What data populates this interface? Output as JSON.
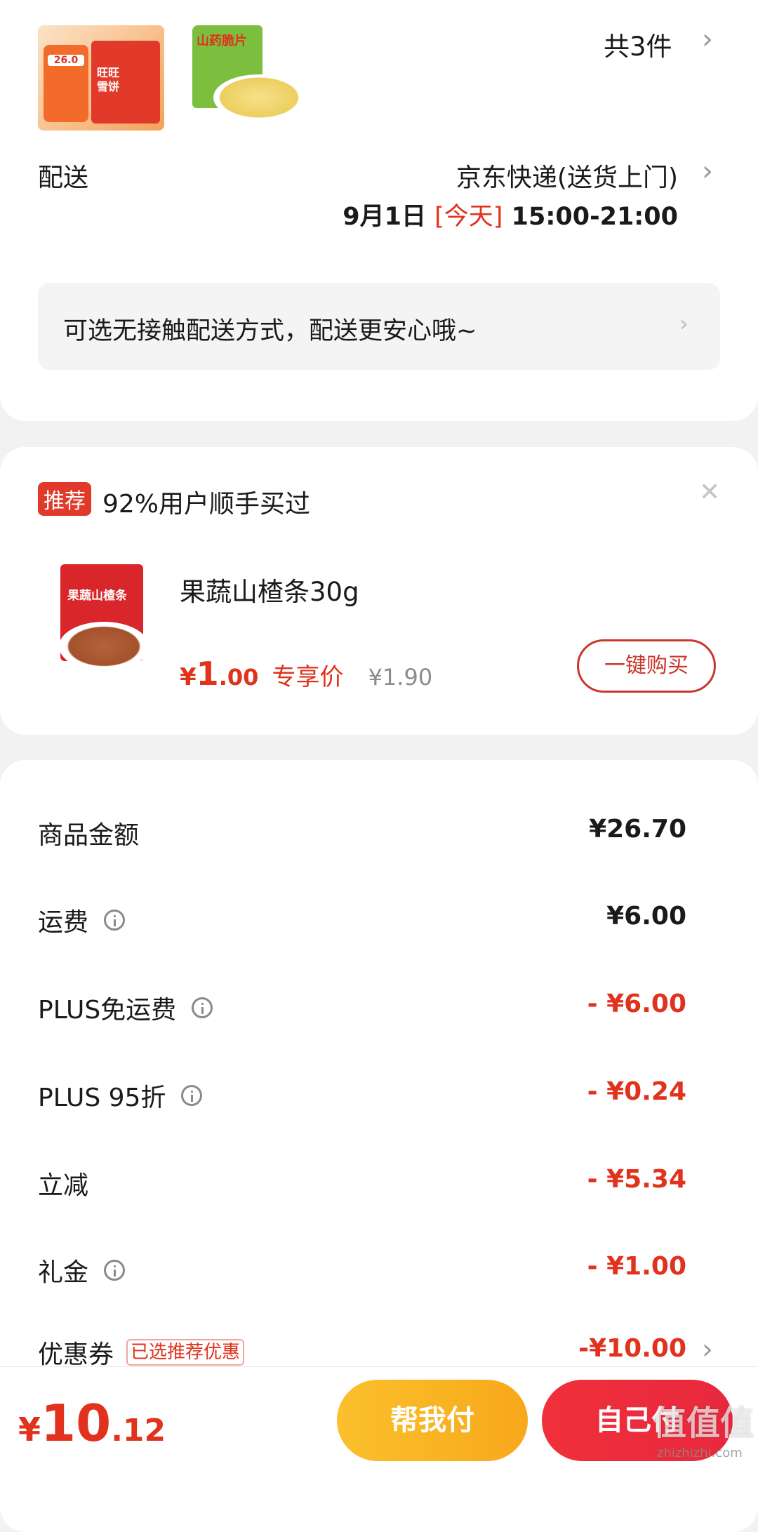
{
  "order": {
    "item_count": "共3件",
    "thumbs": [
      {
        "badge": "26.0",
        "brand": "旺旺 雪饼"
      },
      {
        "brand": "山药脆片"
      }
    ]
  },
  "delivery": {
    "label": "配送",
    "carrier": "京东快递(送货上门)",
    "date": "9月1日",
    "today": "[今天]",
    "time": "15:00-21:00",
    "contactless": "可选无接触配送方式，配送更安心哦~"
  },
  "recommend": {
    "tag": "推荐",
    "title": "92%用户顺手买过",
    "product_name": "果蔬山楂条30g",
    "product_image_text": "果蔬山楂条",
    "price_symbol": "¥",
    "price_int": "1",
    "price_dec": ".00",
    "price_note": "专享价",
    "original_price": "¥1.90",
    "buy_label": "一键购买"
  },
  "summary": {
    "rows": [
      {
        "label": "商品金额",
        "value": "¥26.70"
      },
      {
        "label": "运费",
        "value": "¥6.00"
      },
      {
        "label": "PLUS免运费",
        "value": "- ¥6.00"
      },
      {
        "label": "PLUS 95折",
        "value": "- ¥0.24"
      },
      {
        "label": "立减",
        "value": "- ¥5.34"
      },
      {
        "label": "礼金",
        "value": "- ¥1.00"
      },
      {
        "label": "优惠券",
        "tag": "已选推荐优惠",
        "value": "-¥10.00"
      }
    ]
  },
  "footer": {
    "total_symbol": "¥",
    "total_int": "10",
    "total_dec": ".12",
    "help_pay": "帮我付",
    "self_pay": "自己付",
    "watermark": "值值值",
    "watermark_url": "zhizhizhi.com"
  },
  "colors": {
    "accent": "#e0321c",
    "yellow": "#fbc02d",
    "red_btn": "#f0303a"
  }
}
